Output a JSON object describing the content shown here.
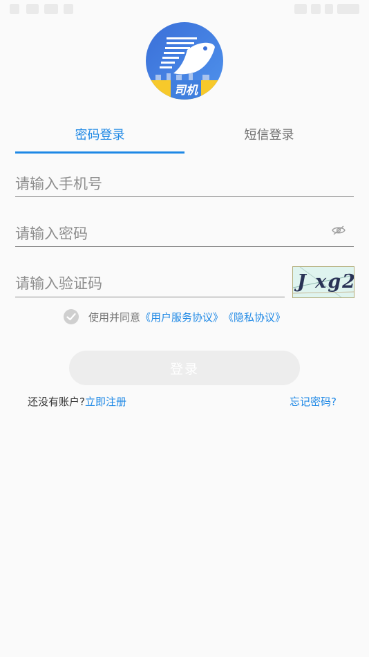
{
  "logo": {
    "badge_text": "司机",
    "colors": {
      "primary": "#3f7fde",
      "badge": "#f7c92b"
    }
  },
  "tabs": [
    {
      "label": "密码登录",
      "active": true
    },
    {
      "label": "短信登录",
      "active": false
    }
  ],
  "form": {
    "phone_placeholder": "请输入手机号",
    "password_placeholder": "请输入密码",
    "code_placeholder": "请输入验证码",
    "captcha_text": "J xg2"
  },
  "agreement": {
    "prefix": "使用并同意",
    "user_agreement": "《用户服务协议》",
    "privacy_policy": "《隐私协议》",
    "checked": false
  },
  "login_button": "登录",
  "footer": {
    "no_account": "还没有账户?",
    "register": "立即注册",
    "forgot": "忘记密码?"
  },
  "theme": {
    "accent": "#1e88e5",
    "icons": [
      "eye-off-icon",
      "check-icon"
    ]
  }
}
